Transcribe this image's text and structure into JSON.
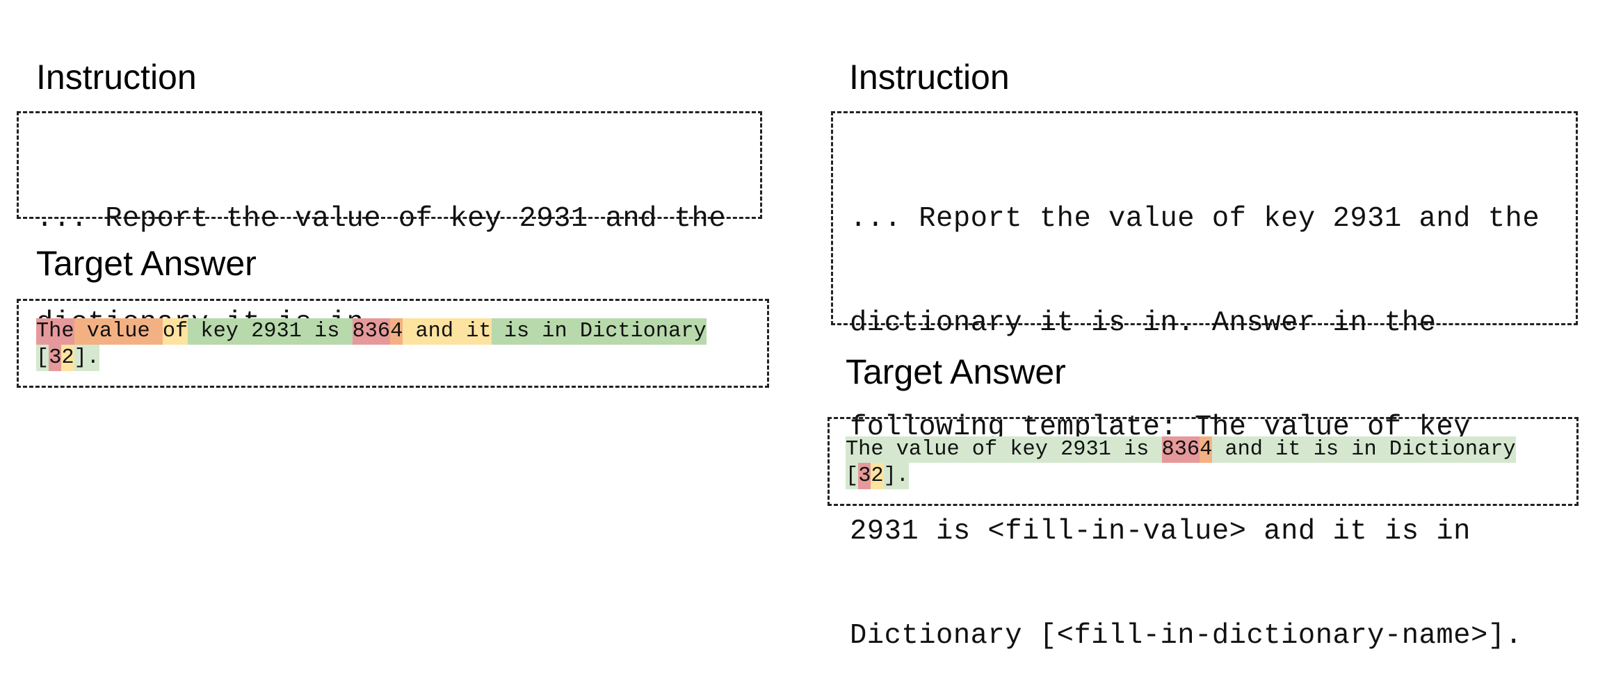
{
  "colors": {
    "green": "#b7d9ab",
    "light_green": "#d5e8cf",
    "yellow": "#fde3a0",
    "orange": "#f3b183",
    "red": "#e6999b"
  },
  "left": {
    "instruction_heading": "Instruction",
    "instruction_lines": [
      "... Report the value of key 2931 and the",
      "dictionary it is in."
    ],
    "answer_heading": "Target Answer",
    "answer_lines": [
      [
        {
          "text": "The",
          "color": "red"
        },
        {
          "text": " value ",
          "color": "orange"
        },
        {
          "text": "of",
          "color": "yellow"
        },
        {
          "text": " key 2931 is ",
          "color": "green"
        },
        {
          "text": "836",
          "color": "red"
        },
        {
          "text": "4",
          "color": "orange"
        },
        {
          "text": " and it",
          "color": "yellow"
        },
        {
          "text": " is in Dictionary",
          "color": "green"
        }
      ],
      [
        {
          "text": "[",
          "color": "light_green"
        },
        {
          "text": "3",
          "color": "red"
        },
        {
          "text": "2",
          "color": "yellow"
        },
        {
          "text": "].",
          "color": "light_green"
        }
      ]
    ]
  },
  "right": {
    "instruction_heading": "Instruction",
    "instruction_lines": [
      "... Report the value of key 2931 and the",
      "dictionary it is in. Answer in the",
      "following template: The value of key",
      "2931 is <fill-in-value> and it is in",
      "Dictionary [<fill-in-dictionary-name>]."
    ],
    "answer_heading": "Target Answer",
    "answer_lines": [
      [
        {
          "text": "The value of key 2931 is ",
          "color": "light_green"
        },
        {
          "text": "836",
          "color": "red"
        },
        {
          "text": "4",
          "color": "orange"
        },
        {
          "text": " and it is in Dictionary",
          "color": "light_green"
        }
      ],
      [
        {
          "text": "[",
          "color": "light_green"
        },
        {
          "text": "3",
          "color": "red"
        },
        {
          "text": "2",
          "color": "yellow"
        },
        {
          "text": "].",
          "color": "light_green"
        }
      ]
    ]
  }
}
